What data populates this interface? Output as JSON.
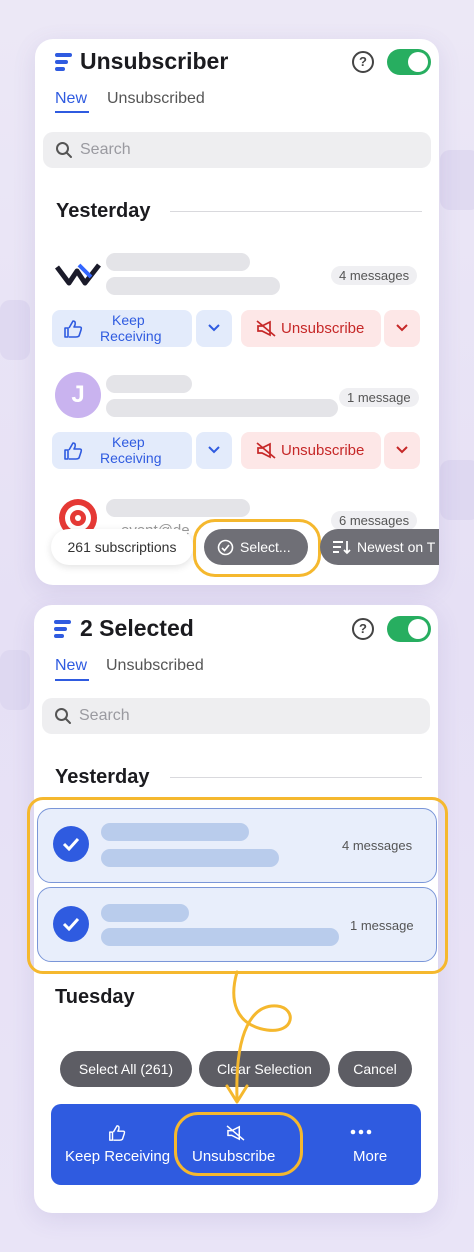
{
  "screen1": {
    "title": "Unsubscriber",
    "help_glyph": "?",
    "tabs": [
      "New",
      "Unsubscribed"
    ],
    "search_placeholder": "Search",
    "section": "Yesterday",
    "rows": [
      {
        "badge": "4 messages",
        "avatar_letter": "",
        "keep_label": "Keep\nReceiving",
        "unsub_label": "Unsubscribe"
      },
      {
        "badge": "1 message",
        "avatar_letter": "J",
        "keep_label": "Keep\nReceiving",
        "unsub_label": "Unsubscribe"
      },
      {
        "badge": "6 messages",
        "partial_text": "event@de"
      }
    ],
    "bottom_bar": {
      "count": "261 subscriptions",
      "select": "Select...",
      "sort": "Newest on T"
    }
  },
  "screen2": {
    "title": "2 Selected",
    "help_glyph": "?",
    "tabs": [
      "New",
      "Unsubscribed"
    ],
    "search_placeholder": "Search",
    "section_yesterday": "Yesterday",
    "section_tuesday": "Tuesday",
    "selected_rows": [
      {
        "badge": "4 messages"
      },
      {
        "badge": "1 message"
      }
    ],
    "selection_actions": {
      "select_all": "Select All (261)",
      "clear": "Clear Selection",
      "cancel": "Cancel"
    },
    "action_bar": {
      "keep": "Keep Receiving",
      "unsub": "Unsubscribe",
      "more": "More"
    }
  },
  "colors": {
    "accent": "#2f5be0",
    "toggle_on": "#27ae60",
    "unsubscribe_red": "#c62828",
    "highlight": "#f5b82e"
  },
  "icons": [
    "menu-icon",
    "help-icon",
    "toggle",
    "search-icon",
    "thumbs-up-icon",
    "chevron-down-icon",
    "megaphone-off-icon",
    "check-circle-icon",
    "sort-icon",
    "more-icon",
    "check-icon",
    "arrow-icon"
  ]
}
